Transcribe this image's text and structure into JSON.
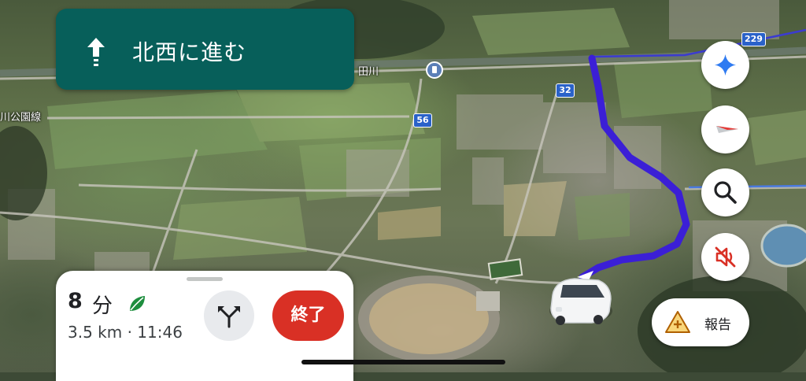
{
  "banner": {
    "instruction": "北西に進む",
    "arrow_icon": "straight-arrow-icon",
    "background_color": "#075f5a"
  },
  "map": {
    "labels": {
      "river_label": "田川",
      "park_line_label": "川公園線"
    },
    "route_shields": [
      "229",
      "32",
      "56"
    ],
    "route_color": "#3b1fd6",
    "shield_color": "#2a62c9"
  },
  "right_controls": {
    "gemini_button": "sparkle-icon",
    "compass_button": "compass-icon",
    "search_button": "search-icon",
    "mute_button": "volume-off-icon",
    "report_label": "報告",
    "report_icon": "report-warning-icon"
  },
  "trip": {
    "eta_minutes": "8",
    "eta_unit": "分",
    "eco_icon": "leaf-icon",
    "distance_and_arrival": "3.5 km · 11:46",
    "alternate_routes_icon": "fork-arrows-icon",
    "end_label": "終了",
    "end_color": "#d93025"
  }
}
